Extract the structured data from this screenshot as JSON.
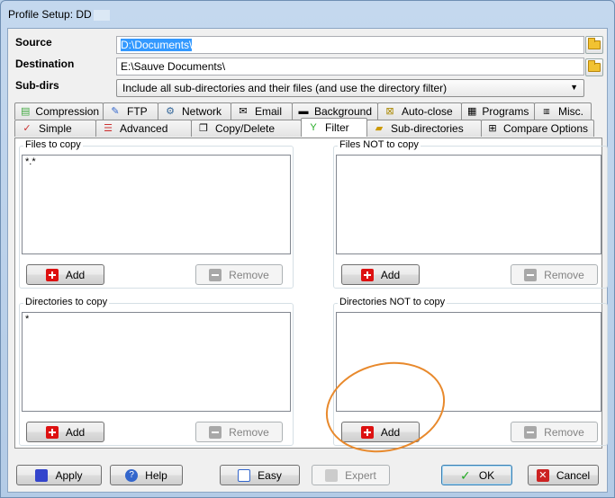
{
  "window": {
    "title": "Profile Setup: DD"
  },
  "source": {
    "label": "Source",
    "value": "D:\\Documents\\"
  },
  "destination": {
    "label": "Destination",
    "value": "E:\\Sauve Documents\\"
  },
  "subdirs": {
    "label": "Sub-dirs",
    "selected": "Include all sub-directories and their files (and use the directory filter)"
  },
  "tabs_row1": [
    {
      "label": "Compression",
      "icon": "compression-icon"
    },
    {
      "label": "FTP",
      "icon": "ftp-icon"
    },
    {
      "label": "Network",
      "icon": "network-icon"
    },
    {
      "label": "Email",
      "icon": "email-icon"
    },
    {
      "label": "Background",
      "icon": "background-icon"
    },
    {
      "label": "Auto-close",
      "icon": "auto-close-icon"
    },
    {
      "label": "Programs",
      "icon": "programs-icon"
    },
    {
      "label": "Misc.",
      "icon": "misc-icon"
    }
  ],
  "tabs_row2": [
    {
      "label": "Simple",
      "icon": "simple-icon"
    },
    {
      "label": "Advanced",
      "icon": "advanced-icon"
    },
    {
      "label": "Copy/Delete",
      "icon": "copy-delete-icon"
    },
    {
      "label": "Filter",
      "icon": "filter-icon",
      "active": true
    },
    {
      "label": "Sub-directories",
      "icon": "sub-directories-icon"
    },
    {
      "label": "Compare Options",
      "icon": "compare-options-icon"
    }
  ],
  "filter": {
    "files_to_copy": {
      "title": "Files to copy",
      "items": [
        "*.*"
      ]
    },
    "files_not_to_copy": {
      "title": "Files NOT to copy",
      "items": []
    },
    "dirs_to_copy": {
      "title": "Directories to copy",
      "items": [
        "*"
      ]
    },
    "dirs_not_to_copy": {
      "title": "Directories NOT to copy",
      "items": []
    },
    "add_label": "Add",
    "remove_label": "Remove"
  },
  "footer": {
    "apply": "Apply",
    "help": "Help",
    "easy": "Easy",
    "expert": "Expert",
    "ok": "OK",
    "cancel": "Cancel"
  },
  "colors": {
    "annotation_circle": "#e8892c",
    "selection": "#3399ff"
  }
}
